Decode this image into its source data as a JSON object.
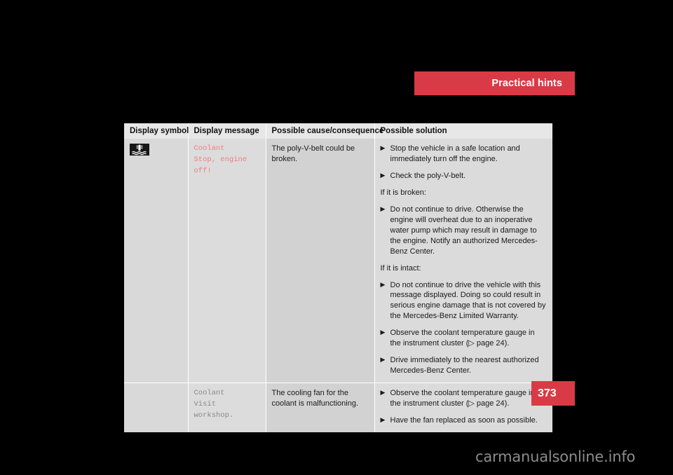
{
  "header": {
    "title": "Practical hints",
    "banner_color": "#d83b45"
  },
  "page_footer": {
    "page_number": "373",
    "tab_color": "#d83b45"
  },
  "watermark": {
    "text": "carmanualsonline.info"
  },
  "table": {
    "columns": [
      "Display symbol",
      "Display message",
      "Possible cause/consequence",
      "Possible solution"
    ],
    "rows": [
      {
        "symbol_icon": "coolant-temperature-warning-icon",
        "message": "Coolant\nStop, engine off!",
        "message_style": "alert",
        "cause": "The poly-V-belt could be broken.",
        "solution": [
          {
            "kind": "bullet",
            "text": "Stop the vehicle in a safe location and immediately turn off the engine."
          },
          {
            "kind": "bullet",
            "text": "Check the poly-V-belt."
          },
          {
            "kind": "note",
            "text": "If it is broken:"
          },
          {
            "kind": "bullet",
            "text": "Do not continue to drive. Otherwise the engine will overheat due to an inoperative water pump which may result in damage to the engine. Notify an authorized Mercedes-Benz Center."
          },
          {
            "kind": "note",
            "text": "If it is intact:"
          },
          {
            "kind": "bullet",
            "text": "Do not continue to drive the vehicle with this message displayed. Doing so could result in serious engine damage that is not covered by the Mercedes-Benz Limited Warranty."
          },
          {
            "kind": "bullet",
            "text": "Observe the coolant temperature gauge in the instrument cluster (▷ page 24)."
          },
          {
            "kind": "bullet",
            "text": "Drive immediately to the nearest authorized Mercedes-Benz Center."
          }
        ]
      },
      {
        "symbol_icon": "",
        "message": "Coolant\nVisit workshop.",
        "message_style": "normal",
        "cause": "The cooling fan for the coolant is malfunctioning.",
        "solution": [
          {
            "kind": "bullet",
            "text": "Observe the coolant temperature gauge in the instrument cluster (▷ page 24)."
          },
          {
            "kind": "bullet",
            "text": "Have the fan replaced as soon as possible."
          }
        ]
      }
    ],
    "bullet_glyph": "▶"
  }
}
